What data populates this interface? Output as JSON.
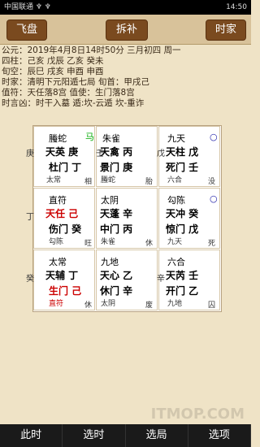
{
  "status": {
    "carrier": "中国联通 ♆ ♆",
    "time": "14:50"
  },
  "toolbar": {
    "left": "飞盘",
    "center": "拆补",
    "right": "时家"
  },
  "info": [
    "公元：2019年4月8日14时50分 三月初四 周一",
    "四柱：己亥    戊辰    乙亥    癸未",
    "旬空：辰巳    戌亥    申酉    申酉",
    "时家：清明下元阳遁七局    旬首：甲戌己",
    "值符：天任落8宫    值使：生门落8宫",
    "时言凶：时干入墓 遁:坎-云遁 坎-重诈"
  ],
  "grid": [
    {
      "top": "螣蛇",
      "topColor": "",
      "corner": "马",
      "lines": [
        "天英 庚",
        "杜门 丁"
      ],
      "bottom": "太常",
      "bottomRight": "相",
      "left": "庚",
      "right": "壬"
    },
    {
      "top": "朱雀",
      "topColor": "",
      "corner": "",
      "lines": [
        "天禽 丙",
        "景门 庚"
      ],
      "bottom": "螣蛇",
      "bottomRight": "胎",
      "left": "",
      "right": ""
    },
    {
      "top": "九天",
      "topColor": "",
      "corner": "○",
      "lines": [
        "天柱 戊",
        "死门 壬"
      ],
      "bottom": "六合",
      "bottomRight": "没",
      "left": "戊",
      "right": ""
    },
    {
      "top": "直符",
      "topColor": "",
      "corner": "",
      "lines": [
        "天任 己",
        "伤门 癸"
      ],
      "bottom": "勾陈",
      "bottomRight": "旺",
      "left": "丁",
      "right": ""
    },
    {
      "top": "太阴",
      "topColor": "",
      "corner": "",
      "lines": [
        "天蓬 辛",
        "中门 丙"
      ],
      "bottom": "朱雀",
      "bottomRight": "休",
      "left": "",
      "right": ""
    },
    {
      "top": "勾陈",
      "topColor": "",
      "corner": "○",
      "lines": [
        "天冲 癸",
        "惊门 戊"
      ],
      "bottom": "九天",
      "bottomRight": "死",
      "left": "",
      "right": ""
    },
    {
      "top": "太常",
      "topColor": "",
      "corner": "",
      "lines": [
        "天辅 丁",
        "生门 己"
      ],
      "bottom": "直符",
      "bottomRight": "休",
      "left": "癸",
      "right": ""
    },
    {
      "top": "九地",
      "topColor": "",
      "corner": "",
      "lines": [
        "天心 乙",
        "休门 辛"
      ],
      "bottom": "太阴",
      "bottomRight": "废",
      "left": "",
      "right": ""
    },
    {
      "top": "六合",
      "topColor": "",
      "corner": "",
      "lines": [
        "天芮 壬",
        "开门 乙"
      ],
      "bottom": "九地",
      "bottomRight": "囚",
      "left": "辛",
      "right": ""
    }
  ],
  "bottomBar": [
    "此时",
    "选时",
    "选局",
    "选项"
  ],
  "watermark": "ITMOP.COM"
}
